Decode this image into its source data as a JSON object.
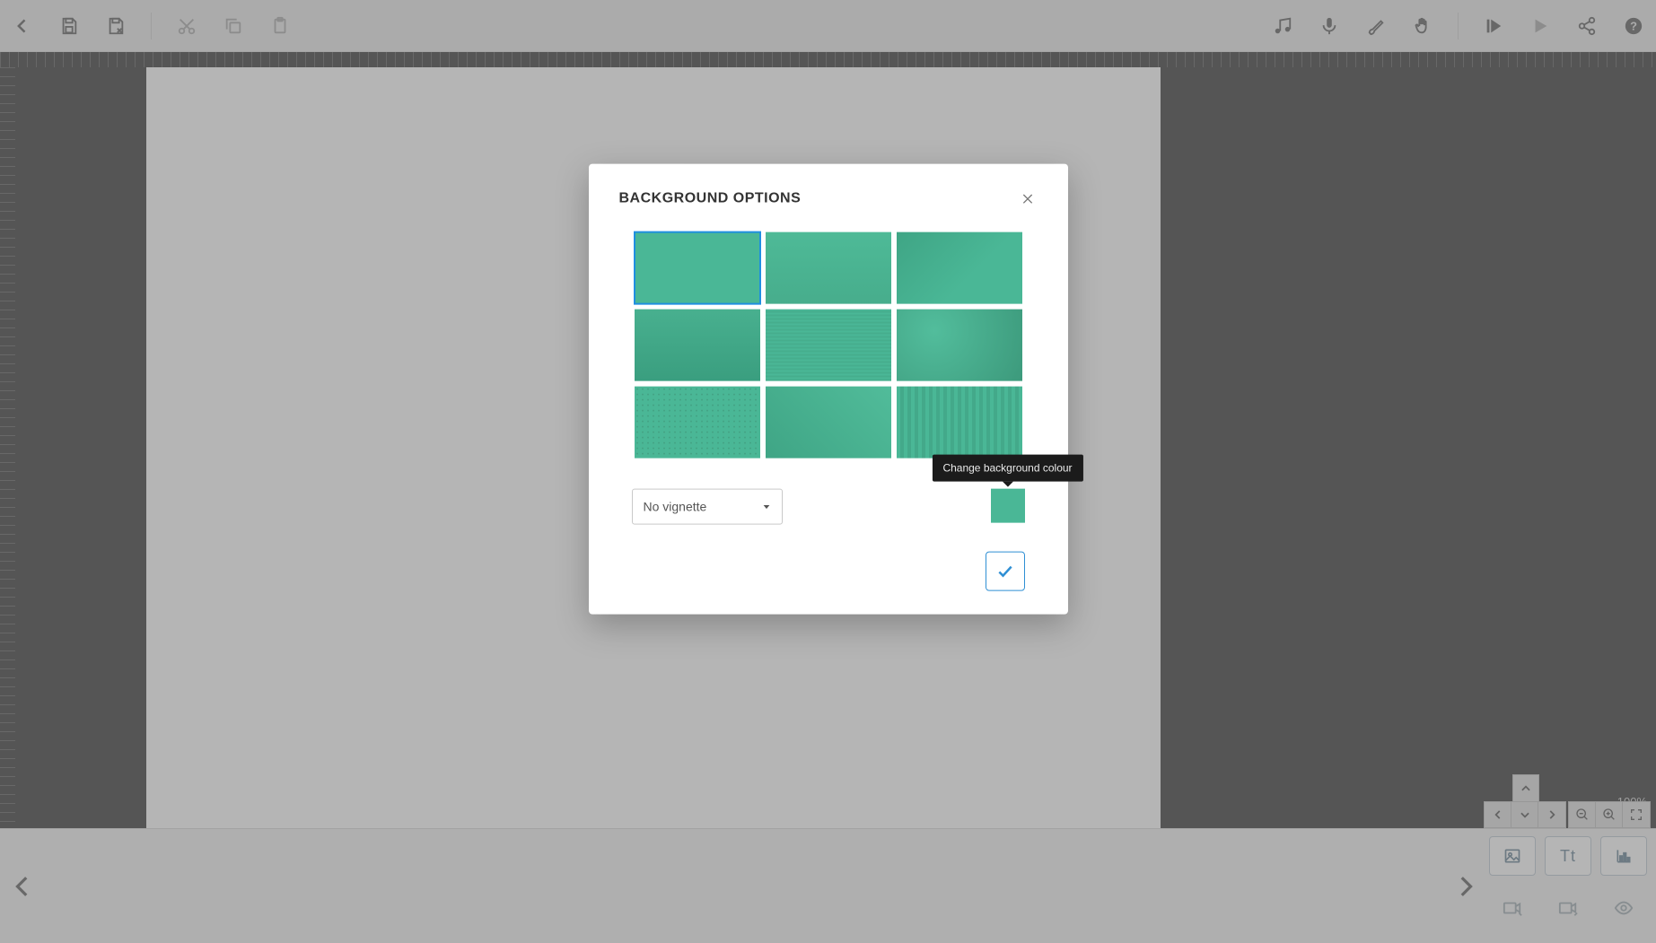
{
  "toolbar": {
    "back": "Back",
    "save": "Save",
    "save_as": "Save As",
    "cut": "Cut",
    "copy": "Copy",
    "paste": "Paste",
    "music": "Music",
    "mic": "Record audio",
    "brush": "Draw",
    "pan": "Pan",
    "play_from": "Play from start",
    "play": "Play",
    "share": "Share",
    "help": "Help"
  },
  "zoom": {
    "label": "100%"
  },
  "nav": {
    "up": "Up",
    "left": "Left",
    "down": "Down",
    "right": "Right",
    "zoom_out": "Zoom out",
    "zoom_in": "Zoom in",
    "fullscreen": "Fullscreen"
  },
  "slides": {
    "prev": "Previous slide",
    "next": "Next slide"
  },
  "insert": {
    "image": "Image",
    "text": "Text",
    "chart": "Chart",
    "camera1": "Camera in",
    "camera2": "Camera out",
    "view": "View"
  },
  "dialog": {
    "title": "BACKGROUND OPTIONS",
    "close": "Close",
    "vignette_value": "No vignette",
    "color_tooltip": "Change background colour",
    "confirm": "Confirm",
    "selected_index": 0,
    "swatch_color": "#4ab796"
  }
}
